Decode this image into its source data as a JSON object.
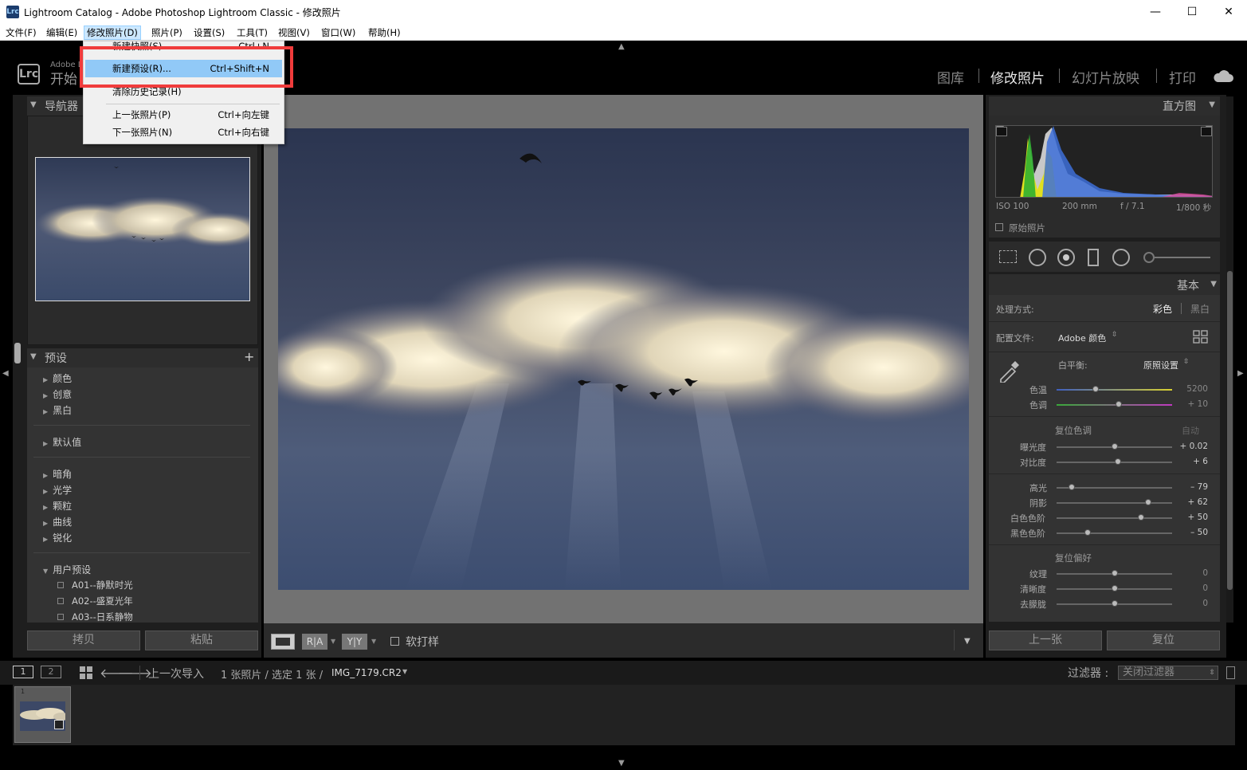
{
  "window": {
    "logo": "Lrc",
    "title": "Lightroom Catalog - Adobe Photoshop Lightroom Classic - 修改照片",
    "minimize": "—",
    "maximize": "☐",
    "close": "✕"
  },
  "menu": [
    {
      "label": "文件(F)"
    },
    {
      "label": "编辑(E)"
    },
    {
      "label": "修改照片(D)"
    },
    {
      "label": "照片(P)"
    },
    {
      "label": "设置(S)"
    },
    {
      "label": "工具(T)"
    },
    {
      "label": "视图(V)"
    },
    {
      "label": "窗口(W)"
    },
    {
      "label": "帮助(H)"
    }
  ],
  "dropdown": {
    "items": [
      {
        "label": "新建快照(S)...",
        "shortcut": "Ctrl+N"
      },
      {
        "label": "新建预设(R)...",
        "shortcut": "Ctrl+Shift+N"
      },
      {
        "label": "清除历史记录(H)",
        "shortcut": ""
      },
      {
        "label": "上一张照片(P)",
        "shortcut": "Ctrl+向左键"
      },
      {
        "label": "下一张照片(N)",
        "shortcut": "Ctrl+向右键"
      }
    ]
  },
  "identity": {
    "badge": "Lrc",
    "line1": "Adobe L",
    "line2": "开始"
  },
  "modules": [
    "图库",
    "修改照片",
    "幻灯片放映",
    "打印"
  ],
  "left_panel": {
    "navigator": "导航器",
    "presets_title": "预设",
    "add": "+",
    "presets": [
      "颜色",
      "创意",
      "黑白",
      "默认值",
      "暗角",
      "光学",
      "颗粒",
      "曲线",
      "锐化",
      "用户预设"
    ],
    "user_presets": [
      "A01--静默时光",
      "A02--盛夏光年",
      "A03--日系静物"
    ],
    "copy_btn": "拷贝",
    "paste_btn": "粘贴"
  },
  "toolbar": {
    "view_ra": "R|A",
    "view_yy": "Y|Y",
    "soft_proof": "软打样"
  },
  "right_panel": {
    "histogram_title": "直方图",
    "iso": "ISO 100",
    "focal": "200 mm",
    "aperture": "f / 7.1",
    "shutter": "1/800 秒",
    "original_photo": "原始照片",
    "basic_title": "基本",
    "treatment_label": "处理方式:",
    "treatment_color": "彩色",
    "treatment_bw": "黑白",
    "profile_label": "配置文件:",
    "profile_value": "Adobe 颜色",
    "wb_label": "白平衡:",
    "wb_value": "原照设置",
    "temp_label": "色温",
    "temp_value": "5200",
    "tint_label": "色调",
    "tint_value": "+ 10",
    "tone_title": "复位色调",
    "auto": "自动",
    "exposure_label": "曝光度",
    "exposure_value": "+ 0.02",
    "contrast_label": "对比度",
    "contrast_value": "+ 6",
    "highlights_label": "高光",
    "highlights_value": "– 79",
    "shadows_label": "阴影",
    "shadows_value": "+ 62",
    "whites_label": "白色色阶",
    "whites_value": "+ 50",
    "blacks_label": "黑色色阶",
    "blacks_value": "– 50",
    "presence_title": "复位偏好",
    "texture_label": "纹理",
    "texture_value": "0",
    "clarity_label": "清晰度",
    "clarity_value": "0",
    "dehaze_label": "去朦胧",
    "dehaze_value": "0",
    "prev_btn": "上一张",
    "reset_btn": "复位"
  },
  "sliders": {
    "temp": 0.34,
    "tint": 0.54,
    "exposure": 0.5,
    "contrast": 0.53,
    "highlights": 0.13,
    "shadows": 0.79,
    "whites": 0.73,
    "blacks": 0.27,
    "texture": 0.5,
    "clarity": 0.5,
    "dehaze": 0.5
  },
  "filmstrip": {
    "view1": "1",
    "view2": "2",
    "source": "上一次导入",
    "count": "1 张照片 / 选定 1 张 /",
    "filename": "IMG_7179.CR2",
    "filter_label": "过滤器 :",
    "filter_value": "关闭过滤器",
    "thumb_index": "1"
  }
}
